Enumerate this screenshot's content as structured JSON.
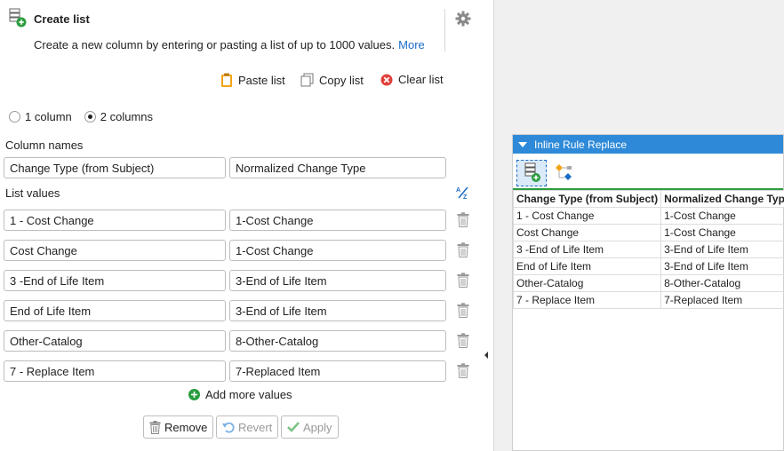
{
  "header": {
    "title": "Create list",
    "description": "Create a new column by entering or pasting a list of up to 1000 values.",
    "more_link": "More"
  },
  "toolbar": {
    "paste": "Paste list",
    "copy": "Copy list",
    "clear": "Clear list"
  },
  "columns_option": {
    "one": "1 column",
    "two": "2 columns",
    "selected": "2 columns"
  },
  "column_names": {
    "label": "Column names",
    "name1": "Change Type (from Subject)",
    "name2": "Normalized Change Type"
  },
  "list_values": {
    "label": "List values",
    "rows": [
      {
        "c1": "1 - Cost Change",
        "c2": "1-Cost Change"
      },
      {
        "c1": "Cost Change",
        "c2": "1-Cost Change"
      },
      {
        "c1": "3 -End of Life Item",
        "c2": "3-End of Life Item"
      },
      {
        "c1": "End of Life Item",
        "c2": "3-End of Life Item"
      },
      {
        "c1": "Other-Catalog",
        "c2": "8-Other-Catalog"
      },
      {
        "c1": "7 - Replace Item",
        "c2": "7-Replaced Item"
      }
    ]
  },
  "add_more": "Add more values",
  "buttons": {
    "remove": "Remove",
    "revert": "Revert",
    "apply": "Apply"
  },
  "inline_panel": {
    "title": "Inline Rule Replace",
    "headers": [
      "Change Type (from Subject)",
      "Normalized Change Type"
    ],
    "rows": [
      [
        "1 - Cost Change",
        "1-Cost Change"
      ],
      [
        "Cost Change",
        "1-Cost Change"
      ],
      [
        "3 -End of Life Item",
        "3-End of Life Item"
      ],
      [
        "End of Life Item",
        "3-End of Life Item"
      ],
      [
        "Other-Catalog",
        "8-Other-Catalog"
      ],
      [
        "7 - Replace Item",
        "7-Replaced Item"
      ]
    ]
  },
  "colors": {
    "accent_blue": "#2e8ad8",
    "link_blue": "#1a6bc6",
    "green": "#2a9d3e",
    "red": "#e0413a",
    "orange": "#f2a516"
  }
}
